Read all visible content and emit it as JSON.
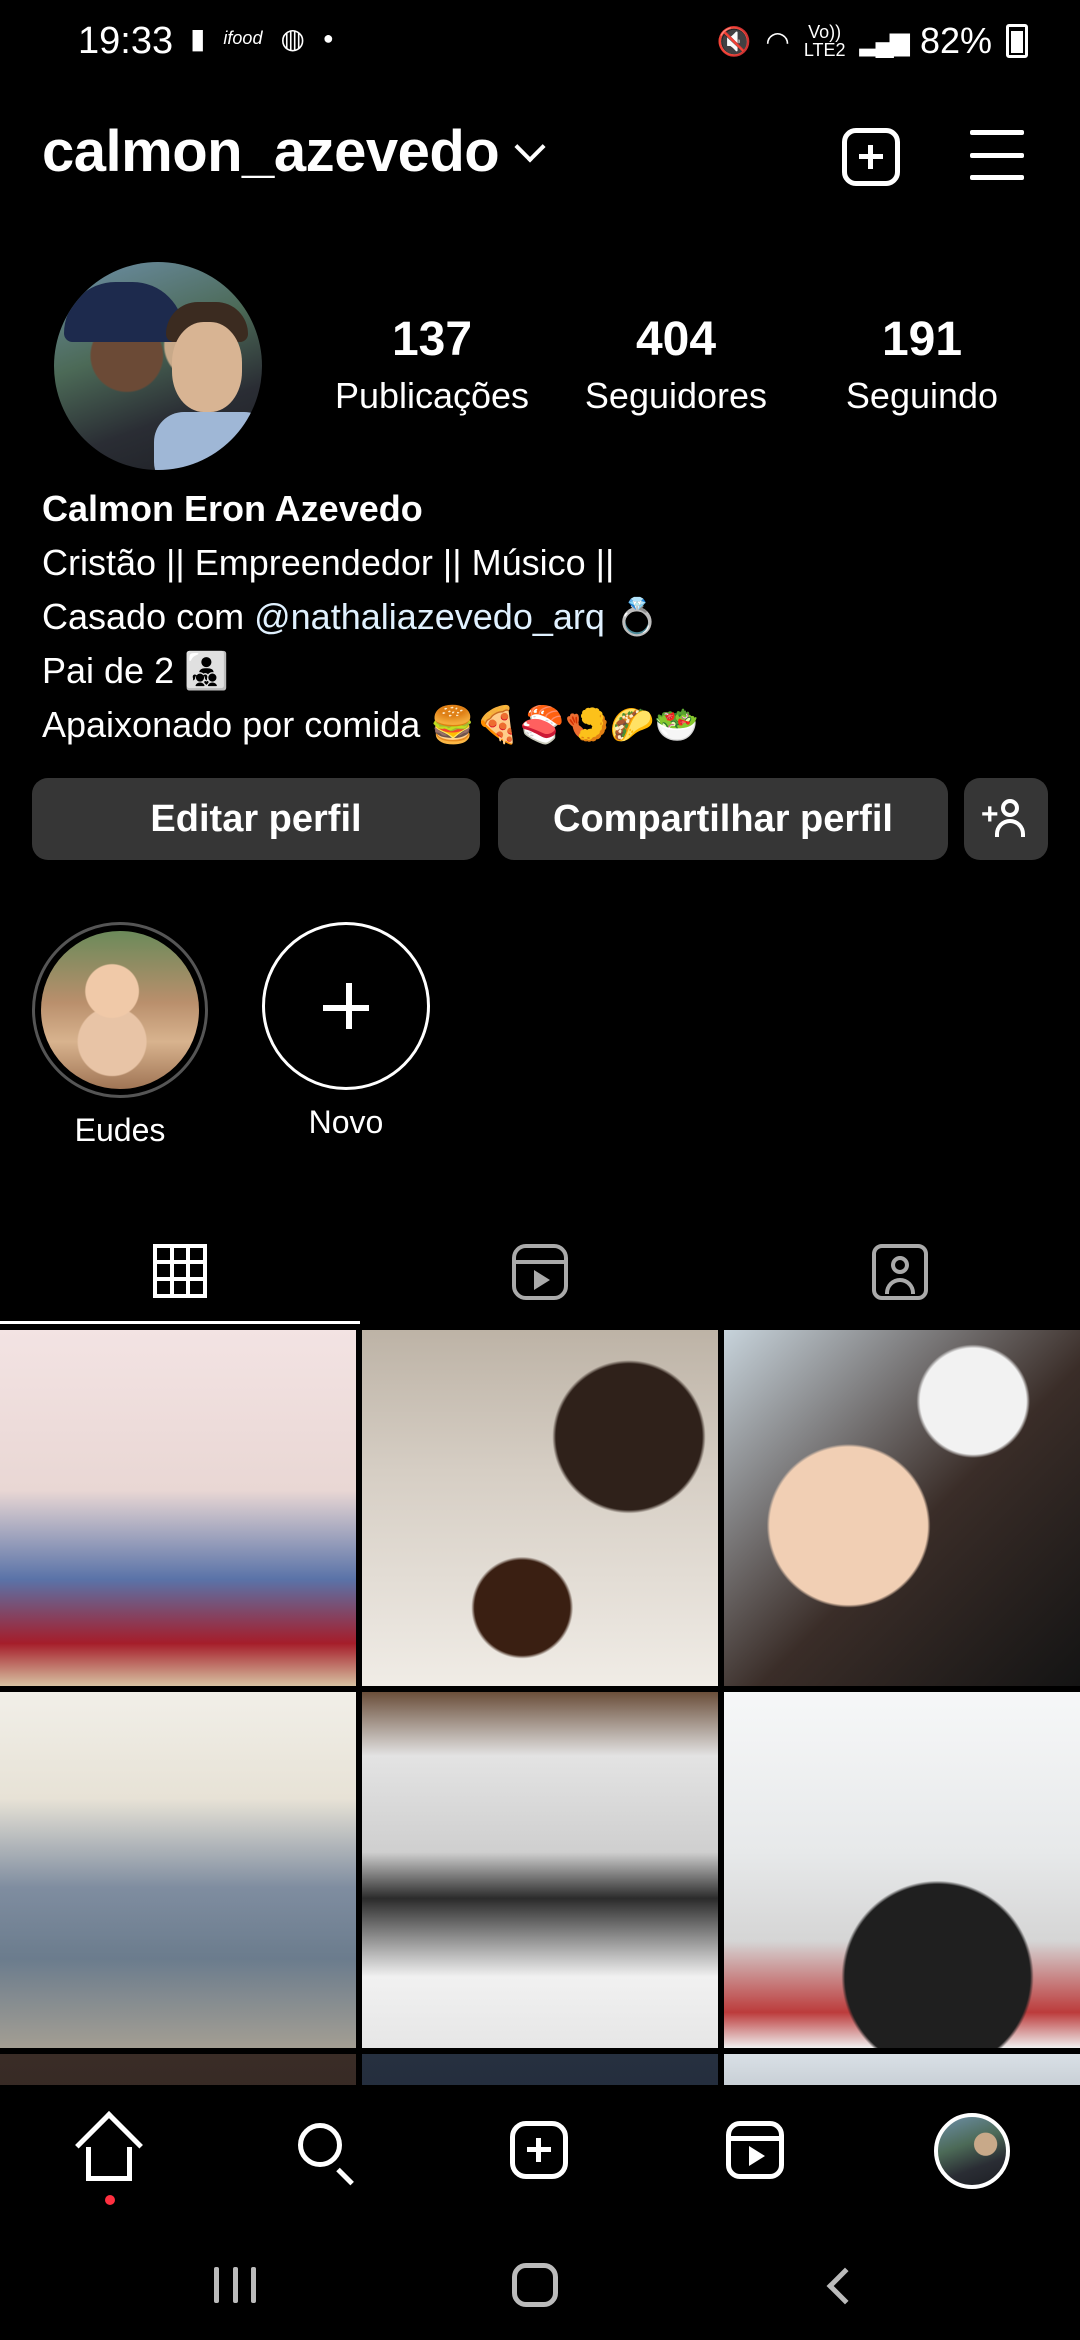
{
  "status_bar": {
    "time": "19:33",
    "left_icons": [
      "chat-icon",
      "ifood-icon",
      "chrome-icon",
      "dot-icon"
    ],
    "volte_label": "Vo))\nLTE2",
    "battery": "82%",
    "right_icons": [
      "mute-icon",
      "wifi-icon",
      "signal-icon",
      "battery-icon"
    ]
  },
  "header": {
    "username": "calmon_azevedo",
    "icons": [
      "chevron-down-icon",
      "add-post-icon",
      "hamburger-menu-icon"
    ]
  },
  "stats": {
    "posts": {
      "count": "137",
      "label": "Publicações"
    },
    "followers": {
      "count": "404",
      "label": "Seguidores"
    },
    "following": {
      "count": "191",
      "label": "Seguindo"
    }
  },
  "bio": {
    "name": "Calmon Eron Azevedo",
    "line1": "Cristão || Empreendedor || Músico ||",
    "line2_prefix": "Casado com ",
    "line2_mention": "@nathaliazevedo_arq",
    "line2_emoji": "💍",
    "line3_text": "Pai de 2",
    "line3_emoji": "👨‍👧‍👦",
    "line4_text": "Apaixonado por comida",
    "line4_emojis": [
      "🍔",
      "🍕",
      "🍣",
      "🍤",
      "🌮",
      "🥗"
    ]
  },
  "buttons": {
    "edit": "Editar perfil",
    "share": "Compartilhar perfil",
    "add_person_icon": "add-person-icon"
  },
  "highlights": [
    {
      "label": "Eudes"
    },
    {
      "label": "Novo"
    }
  ],
  "tabs": [
    {
      "name": "posts",
      "icon": "grid-icon",
      "active": true
    },
    {
      "name": "reels",
      "icon": "reels-icon",
      "active": false
    },
    {
      "name": "tagged",
      "icon": "tagged-icon",
      "active": false
    }
  ],
  "grid": {
    "photos": [
      {
        "desc_icon": "photo"
      },
      {
        "desc_icon": "photo"
      },
      {
        "desc_icon": "photo"
      },
      {
        "desc_icon": "photo"
      },
      {
        "desc_icon": "photo"
      },
      {
        "desc_icon": "photo"
      },
      {
        "desc_icon": "photo"
      },
      {
        "desc_icon": "photo"
      },
      {
        "desc_icon": "photo"
      }
    ]
  },
  "bottom_nav": {
    "items": [
      "home-icon",
      "search-icon",
      "create-icon",
      "reels-icon",
      "profile-avatar"
    ],
    "notification_dot_color": "#ff3040"
  },
  "system_nav": {
    "items": [
      "recents-icon",
      "home-icon",
      "back-icon"
    ]
  }
}
